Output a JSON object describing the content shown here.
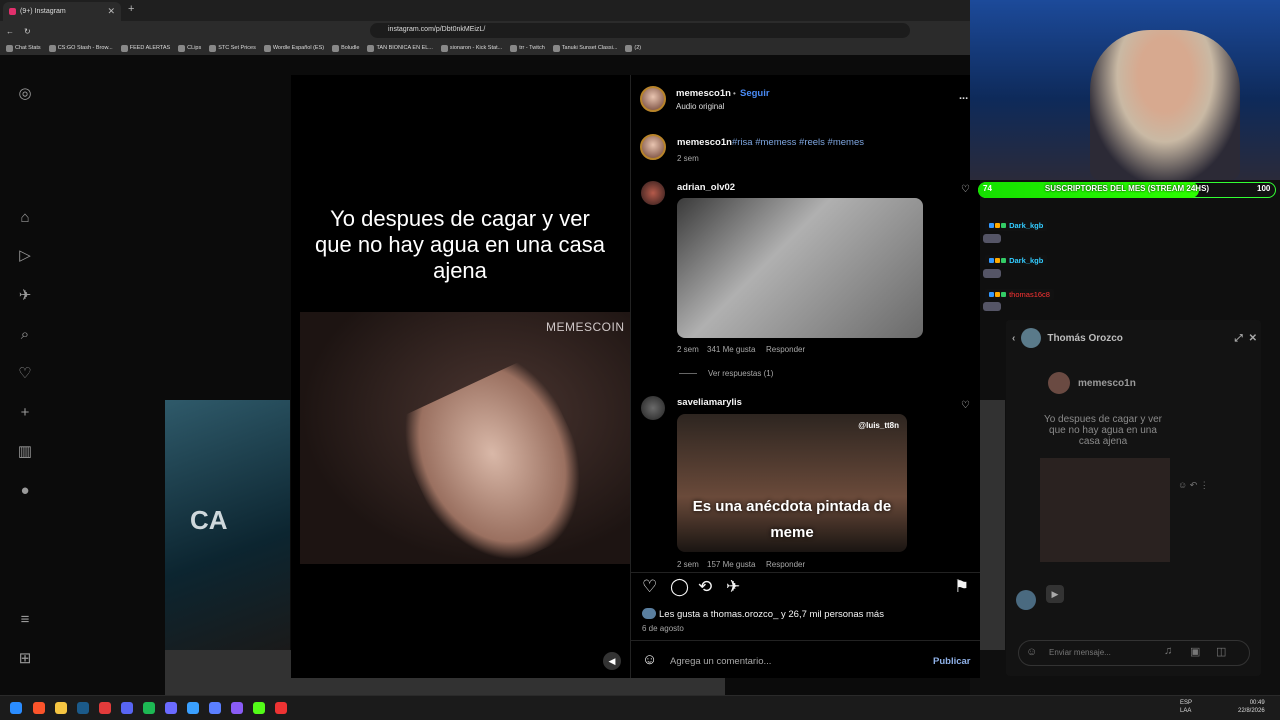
{
  "browser": {
    "tab_title": "(9+) Instagram",
    "new_tab_symbol": "+",
    "url": "instagram.com/p/Dbt0nkMEizL/",
    "bookmarks": [
      "Chat Stats",
      "CS:GO Stash - Brow...",
      "FEED ALERTAS",
      "CLips",
      "STC Set Prices",
      "Wordle Español (ES)",
      "Boludle",
      "TAN BIONICA EN EL...",
      "sionaron - Kick Stat...",
      "trr - Twitch",
      "Tanuki Sunset Classi...",
      "(2)"
    ]
  },
  "reel": {
    "caption": "Yo despues de cagar y ver que no hay agua en una casa ajena",
    "watermark": "MEMESCOIN"
  },
  "post": {
    "author": "memesco1n",
    "follow_label": "Seguir",
    "separator": "•",
    "audio": "Audio original",
    "more": "...",
    "description_user": "memesco1n",
    "description_tags": "#risa #memess #reels #memes",
    "description_time": "2 sem",
    "comments": [
      {
        "user": "adrian_olv02",
        "time": "2 sem",
        "likes": "341 Me gusta",
        "reply": "Responder",
        "view_replies": "Ver respuestas (1)"
      },
      {
        "user": "saveliamarylis",
        "gif_text": "Es una anécdota pintada de meme",
        "gif_tag": "@luis_tt8n",
        "time": "2 sem",
        "likes": "157 Me gusta",
        "reply": "Responder"
      }
    ],
    "liked_by": "Les gusta a thomas.orozco_ y 26,7 mil personas más",
    "date": "6 de agosto",
    "comment_placeholder": "Agrega un comentario...",
    "publish_label": "Publicar"
  },
  "overlay": {
    "sub_goal_text": "SUSCRIPTORES DEL MES (STREAM 24HS)",
    "sub_current": "74",
    "sub_goal": "100",
    "sub_progress": 0.74,
    "chat": [
      {
        "user": "Dark_kgb",
        "color": "#33ccff"
      },
      {
        "user": "Dark_kgb",
        "color": "#33ccff"
      },
      {
        "user": "thomas16c8",
        "color": "#ff3333"
      }
    ]
  },
  "dm": {
    "name": "Thomás Orozco",
    "shared_user": "memesco1n",
    "shared_caption": "Yo despues de cagar y ver que no hay agua en una casa ajena",
    "input_placeholder": "Enviar mensaje..."
  },
  "taskbar": {
    "lang1": "ESP",
    "lang2": "LAA",
    "time": "00:49",
    "date": "22/8/2026"
  }
}
